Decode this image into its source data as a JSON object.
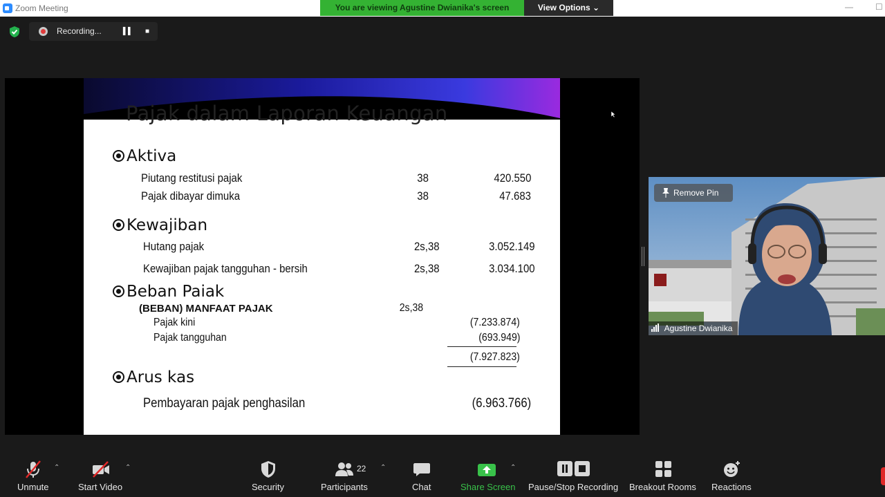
{
  "window": {
    "title": "Zoom Meeting",
    "viewing_banner": "You are viewing Agustine Dwianika's screen",
    "view_options": "View Options"
  },
  "recording": {
    "label": "Recording..."
  },
  "slide": {
    "title": "Pajak dalam Laporan Keuangan",
    "sections": {
      "aktiva": {
        "heading": "Aktiva",
        "rows": [
          {
            "label": "Piutang restitusi pajak",
            "note": "38",
            "value": "420.550"
          },
          {
            "label": "Pajak dibayar dimuka",
            "note": "38",
            "value": "47.683"
          }
        ]
      },
      "kewajiban": {
        "heading": "Kewajiban",
        "rows": [
          {
            "label": "Hutang pajak",
            "note": "2s,38",
            "value": "3.052.149"
          },
          {
            "label": "Kewajiban pajak tangguhan - bersih",
            "note": "2s,38",
            "value": "3.034.100"
          }
        ]
      },
      "beban": {
        "heading": "Beban Paiak",
        "subheading": "(BEBAN) MANFAAT PAJAK",
        "note": "2s,38",
        "rows": [
          {
            "label": "Pajak kini",
            "value": "(7.233.874)"
          },
          {
            "label": "Pajak tangguhan",
            "value": "(693.949)"
          }
        ],
        "total": "(7.927.823)"
      },
      "arus": {
        "heading": "Arus kas",
        "rows": [
          {
            "label": "Pembayaran pajak penghasilan",
            "value": "(6.963.766)"
          }
        ]
      }
    }
  },
  "video": {
    "remove_pin": "Remove Pin",
    "participant_name": "Agustine Dwianika"
  },
  "toolbar": {
    "unmute": "Unmute",
    "start_video": "Start Video",
    "security": "Security",
    "participants": "Participants",
    "participants_count": "22",
    "chat": "Chat",
    "share_screen": "Share Screen",
    "pause_stop_recording": "Pause/Stop Recording",
    "breakout_rooms": "Breakout Rooms",
    "reactions": "Reactions"
  },
  "colors": {
    "banner_green": "#34b233",
    "share_green": "#39c24a",
    "mute_red": "#e02828",
    "zoom_blue": "#2d8cff"
  }
}
